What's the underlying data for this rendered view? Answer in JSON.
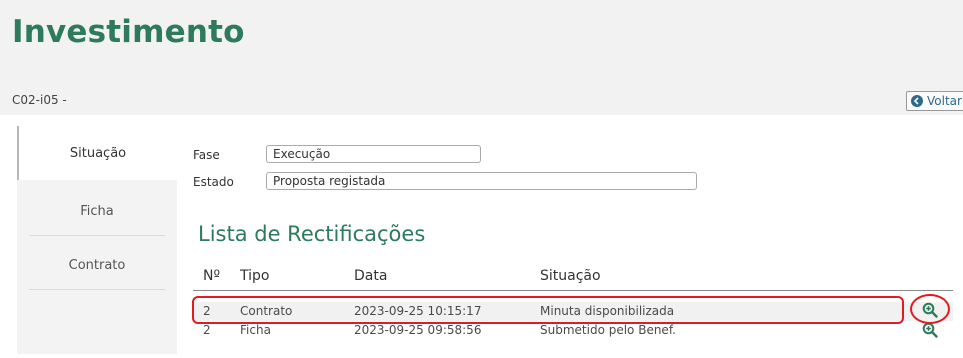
{
  "page": {
    "title": "Investimento",
    "code": "C02-i05 -",
    "back_label": "Voltar"
  },
  "sidebar": {
    "items": [
      {
        "label": "Situação",
        "active": true
      },
      {
        "label": "Ficha",
        "active": false
      },
      {
        "label": "Contrato",
        "active": false
      }
    ]
  },
  "fields": {
    "fase": {
      "label": "Fase",
      "value": "Execução"
    },
    "estado": {
      "label": "Estado",
      "value": "Proposta registada"
    }
  },
  "list": {
    "title": "Lista de Rectificações",
    "columns": [
      "Nº",
      "Tipo",
      "Data",
      "Situação"
    ],
    "rows": [
      {
        "num": "2",
        "tipo": "Contrato",
        "data": "2023-09-25 10:15:17",
        "situacao": "Minuta disponibilizada"
      },
      {
        "num": "2",
        "tipo": "Ficha",
        "data": "2023-09-25 09:58:56",
        "situacao": "Submetido pelo Benef."
      }
    ]
  },
  "colors": {
    "accent": "#2d7a5c",
    "link": "#2d6a8a",
    "highlight": "#e11b22"
  },
  "icons": {
    "back": "back-arrow-circle-icon",
    "row_action": "zoom-in-icon"
  }
}
